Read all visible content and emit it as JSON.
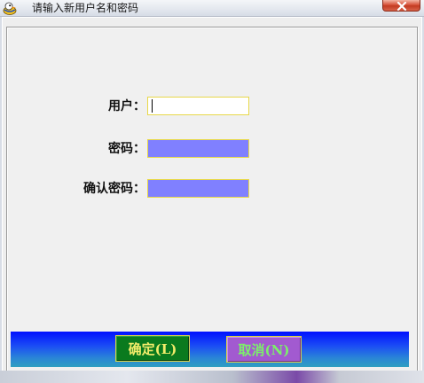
{
  "window": {
    "title": "请输入新用户名和密码",
    "close_glyph": "✕"
  },
  "form": {
    "user_label": "用户：",
    "user_value": "",
    "password_label": "密码：",
    "password_value": "",
    "confirm_label": "确认密码：",
    "confirm_value": ""
  },
  "buttons": {
    "ok_label": "确定(L)",
    "cancel_label": "取消(N)"
  },
  "colors": {
    "button_bar_top": "#0010ff",
    "button_bar_bottom": "#2f9fc0",
    "ok_bg": "#0a7a1e",
    "ok_text": "#f2ec6a",
    "cancel_bg": "#a25ad0",
    "cancel_text": "#7cf06a",
    "password_field_bg": "#8080ff",
    "field_border": "#e8d84a"
  },
  "icons": {
    "app": "duck-app-icon",
    "close": "close-icon"
  }
}
